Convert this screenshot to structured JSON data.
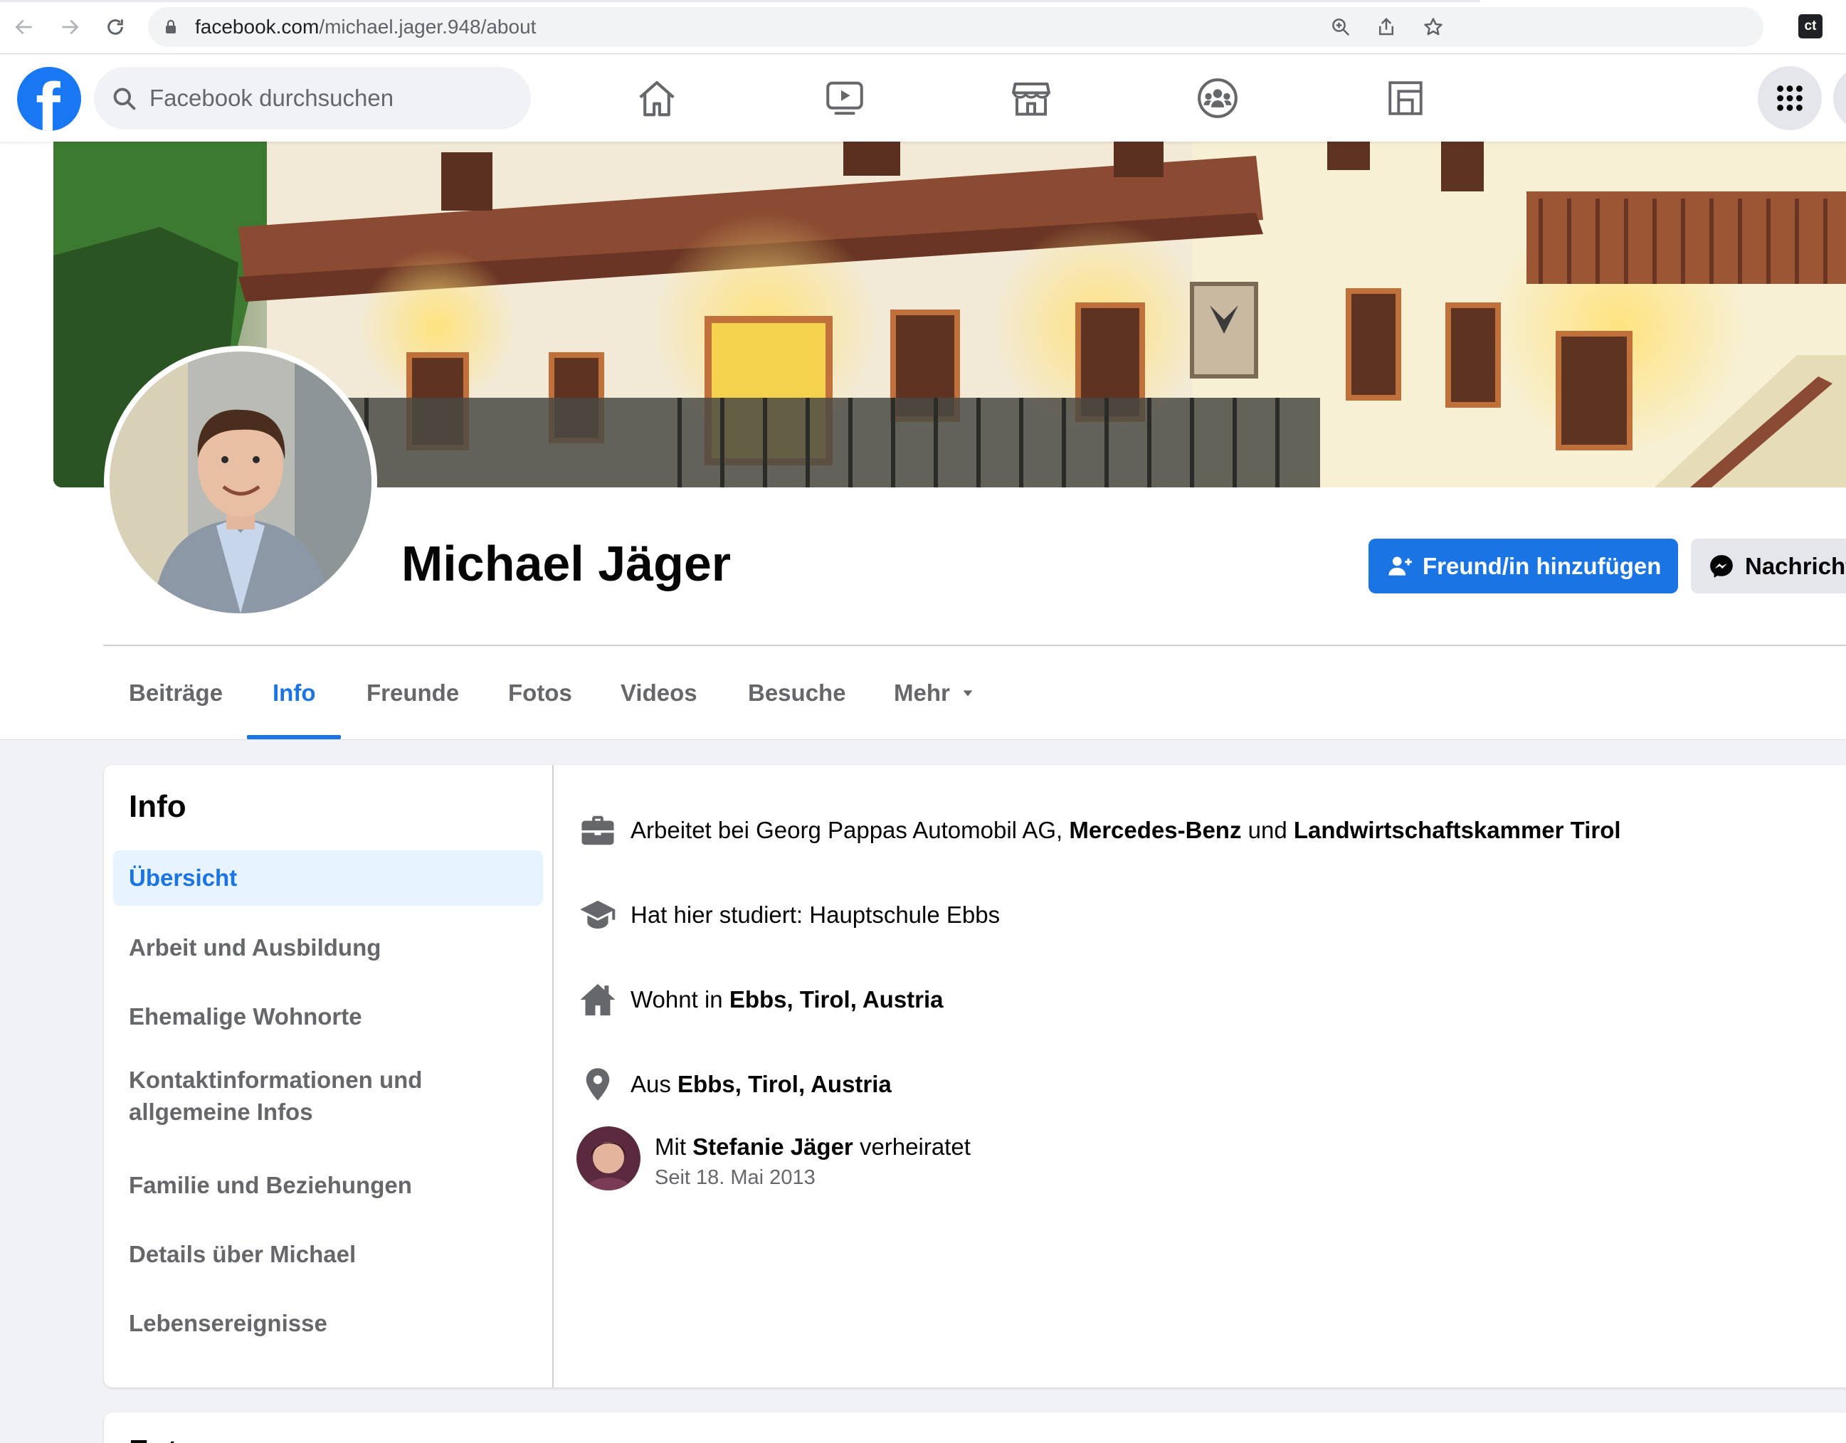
{
  "browser": {
    "url_domain": "facebook.com",
    "url_path": "/michael.jager.948/about",
    "extension_label": "ct"
  },
  "fb": {
    "logo_letter": "f",
    "search_placeholder": "Facebook durchsuchen"
  },
  "profile": {
    "name": "Michael Jäger",
    "add_friend_label": "Freund/in hinzufügen",
    "message_label": "Nachricht"
  },
  "tabs": [
    {
      "label": "Beiträge"
    },
    {
      "label": "Info"
    },
    {
      "label": "Freunde"
    },
    {
      "label": "Fotos"
    },
    {
      "label": "Videos"
    },
    {
      "label": "Besuche"
    },
    {
      "label": "Mehr"
    }
  ],
  "info": {
    "heading": "Info",
    "sidebar": [
      {
        "label": "Übersicht"
      },
      {
        "label": "Arbeit und Ausbildung"
      },
      {
        "label": "Ehemalige Wohnorte"
      },
      {
        "label": "Kontaktinformationen und allgemeine Infos"
      },
      {
        "label": "Familie und Beziehungen"
      },
      {
        "label": "Details über Michael"
      },
      {
        "label": "Lebensereignisse"
      }
    ],
    "work": {
      "prefix": "Arbeitet bei Georg Pappas Automobil AG, ",
      "employer2": "Mercedes-Benz",
      "joiner": " und ",
      "employer3": "Landwirtschaftskammer Tirol"
    },
    "study": {
      "text": "Hat hier studiert: Hauptschule Ebbs"
    },
    "lives": {
      "prefix": "Wohnt in ",
      "place": "Ebbs, Tirol, Austria"
    },
    "from": {
      "prefix": "Aus ",
      "place": "Ebbs, Tirol, Austria"
    },
    "relationship": {
      "prefix": "Mit ",
      "partner": "Stefanie Jäger",
      "suffix": " verheiratet",
      "since": "Seit 18. Mai 2013"
    }
  },
  "next_section": {
    "heading": "Fotos"
  },
  "colors": {
    "fb_blue": "#1877f2",
    "button_blue": "#1b74e4",
    "active_bg": "#e7f3ff",
    "page_bg": "#f0f2f5",
    "secondary_text": "#65676b"
  },
  "icons": {
    "nav": [
      "home-icon",
      "watch-icon",
      "marketplace-icon",
      "groups-icon",
      "gaming-icon"
    ],
    "rows": [
      "briefcase-icon",
      "graduation-cap-icon",
      "house-icon",
      "location-pin-icon"
    ]
  }
}
